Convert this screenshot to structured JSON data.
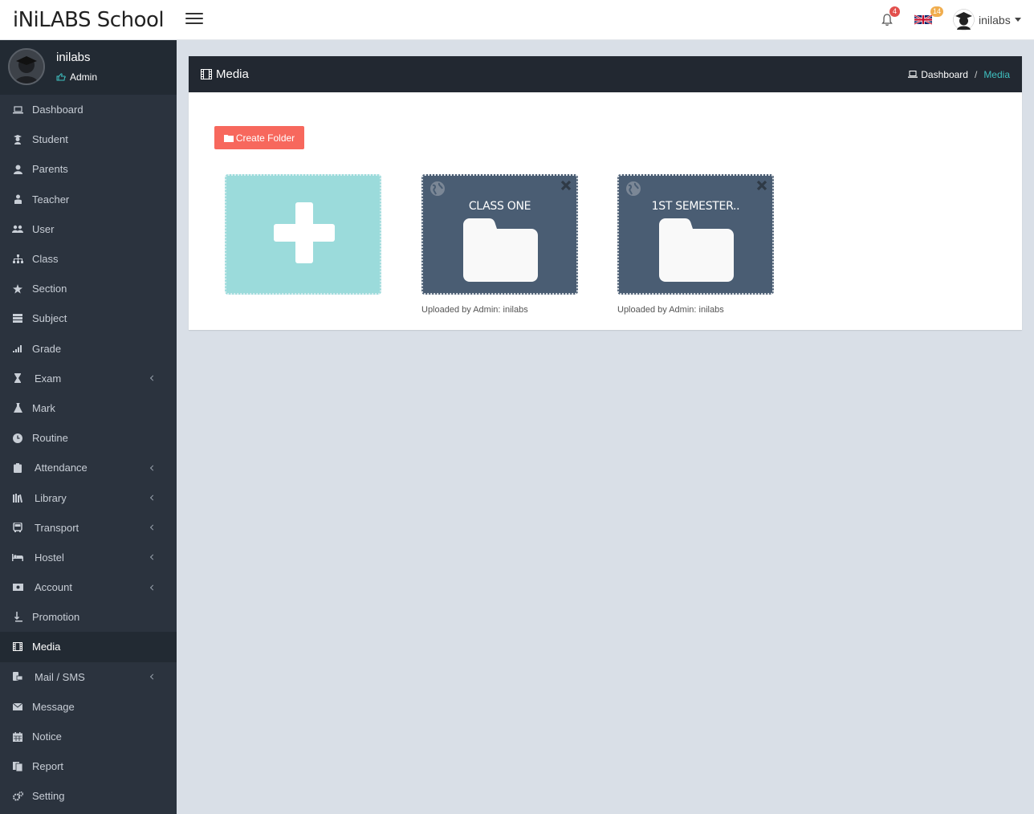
{
  "app": {
    "brand": "iNiLABS School"
  },
  "topbar": {
    "notifications_count": "4",
    "language_count": "14",
    "username": "inilabs",
    "icons": [
      "menu-icon",
      "bell-icon",
      "uk-flag-icon",
      "user-avatar-icon",
      "caret-down-icon"
    ]
  },
  "sidebar": {
    "user": {
      "name": "inilabs",
      "role": "Admin"
    },
    "items": [
      {
        "label": "Dashboard",
        "icon": "laptop-icon",
        "submenu": false
      },
      {
        "label": "Student",
        "icon": "student-icon",
        "submenu": false
      },
      {
        "label": "Parents",
        "icon": "user-icon",
        "submenu": false
      },
      {
        "label": "Teacher",
        "icon": "teacher-icon",
        "submenu": false
      },
      {
        "label": "User",
        "icon": "users-icon",
        "submenu": false
      },
      {
        "label": "Class",
        "icon": "sitemap-icon",
        "submenu": false
      },
      {
        "label": "Section",
        "icon": "star-icon",
        "submenu": false
      },
      {
        "label": "Subject",
        "icon": "book-icon",
        "submenu": false
      },
      {
        "label": "Grade",
        "icon": "signal-icon",
        "submenu": false
      },
      {
        "label": "Exam",
        "icon": "hourglass-icon",
        "submenu": true
      },
      {
        "label": "Mark",
        "icon": "flask-icon",
        "submenu": false
      },
      {
        "label": "Routine",
        "icon": "clock-icon",
        "submenu": false
      },
      {
        "label": "Attendance",
        "icon": "clipboard-icon",
        "submenu": true
      },
      {
        "label": "Library",
        "icon": "library-icon",
        "submenu": true
      },
      {
        "label": "Transport",
        "icon": "bus-icon",
        "submenu": true
      },
      {
        "label": "Hostel",
        "icon": "bed-icon",
        "submenu": true
      },
      {
        "label": "Account",
        "icon": "money-icon",
        "submenu": true
      },
      {
        "label": "Promotion",
        "icon": "promotion-icon",
        "submenu": false
      },
      {
        "label": "Media",
        "icon": "film-icon",
        "submenu": false,
        "active": true
      },
      {
        "label": "Mail / SMS",
        "icon": "mail-sms-icon",
        "submenu": true
      },
      {
        "label": "Message",
        "icon": "envelope-icon",
        "submenu": false
      },
      {
        "label": "Notice",
        "icon": "calendar-icon",
        "submenu": false
      },
      {
        "label": "Report",
        "icon": "files-icon",
        "submenu": false
      },
      {
        "label": "Setting",
        "icon": "gears-icon",
        "submenu": false
      }
    ]
  },
  "page": {
    "title": "Media",
    "breadcrumb": {
      "home": "Dashboard",
      "separator": "/",
      "current": "Media"
    },
    "create_folder_label": "Create Folder",
    "folders": [
      {
        "name": "CLASS ONE",
        "uploader": "Uploaded by Admin: inilabs"
      },
      {
        "name": "1ST SEMESTER..",
        "uploader": "Uploaded by Admin: inilabs"
      }
    ]
  },
  "colors": {
    "sidebar_bg": "#2b333e",
    "header_bg": "#222831",
    "accent_teal": "#3fc0c0",
    "create_button": "#f7685d",
    "add_tile": "#9bdbdb",
    "folder_tile": "#4a5d73",
    "badge_red": "#e2504d",
    "badge_orange": "#f0ad4e"
  }
}
